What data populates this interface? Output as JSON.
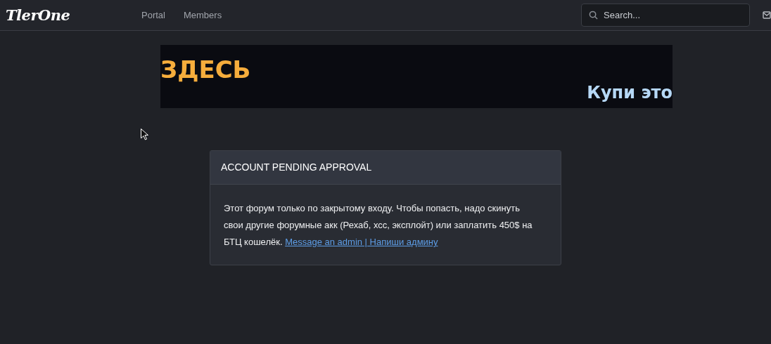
{
  "header": {
    "logo": "TlerOne",
    "nav": [
      {
        "label": "Portal"
      },
      {
        "label": "Members"
      }
    ],
    "search": {
      "placeholder": "Search..."
    }
  },
  "banner": {
    "headline": "ЗДЕСЬ",
    "tagline": "Купи это"
  },
  "notice": {
    "title": "ACCOUNT PENDING APPROVAL",
    "message": "Этот форум только по закрытому входу. Чтобы попасть, надо скинуть свои другие форумные акк (Рехаб, хсс, эксплойт) или заплатить 450$ на БТЦ кошелёк.",
    "link": "Message an admin | Напиши админу"
  }
}
